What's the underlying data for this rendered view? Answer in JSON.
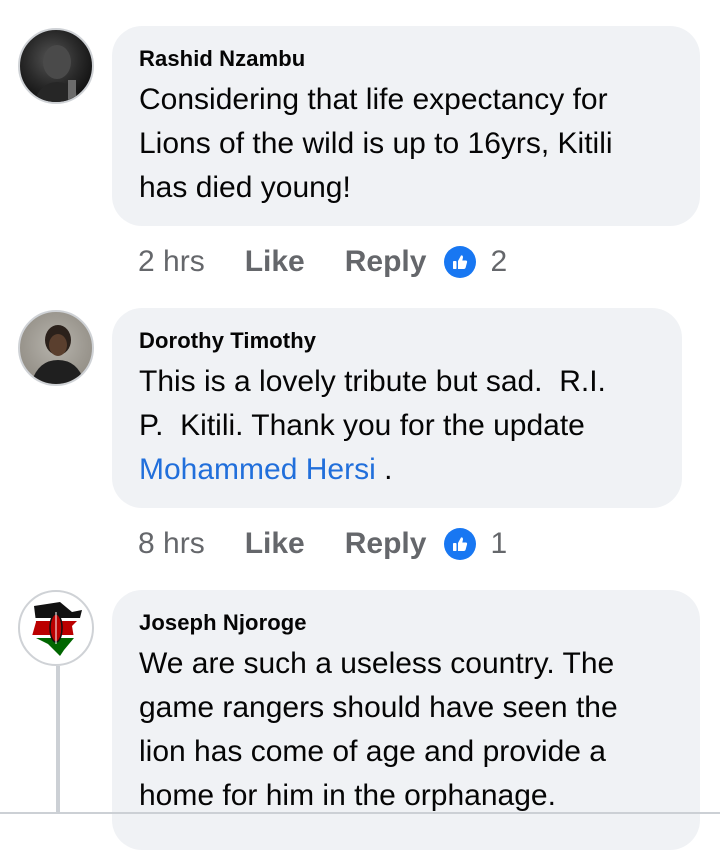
{
  "comments": [
    {
      "author": "Rashid Nzambu",
      "lines": [
        "Considering that life expectancy for",
        "Lions of the wild is up to 16yrs, Kitili",
        "has died young!"
      ],
      "time": "2 hrs",
      "like_label": "Like",
      "reply_label": "Reply",
      "reaction_count": "2"
    },
    {
      "author": "Dorothy Timothy",
      "lines": [
        "This is a lovely tribute but sad.  R.I.",
        "P.  Kitili. Thank you for the update"
      ],
      "mention": "Mohammed Hersi",
      "after_mention": " .",
      "time": "8 hrs",
      "like_label": "Like",
      "reply_label": "Reply",
      "reaction_count": "1"
    },
    {
      "author": "Joseph Njoroge",
      "lines": [
        "We are such a useless country. The",
        "game rangers should have seen the",
        "lion has come of age and provide a",
        "home for him in the orphanage."
      ]
    }
  ],
  "colors": {
    "bubble": "#f0f2f5",
    "link": "#216fdb",
    "like_badge": "#1877f2",
    "meta_text": "#65676b"
  },
  "icons": {
    "reaction": "thumbs-up-icon"
  }
}
